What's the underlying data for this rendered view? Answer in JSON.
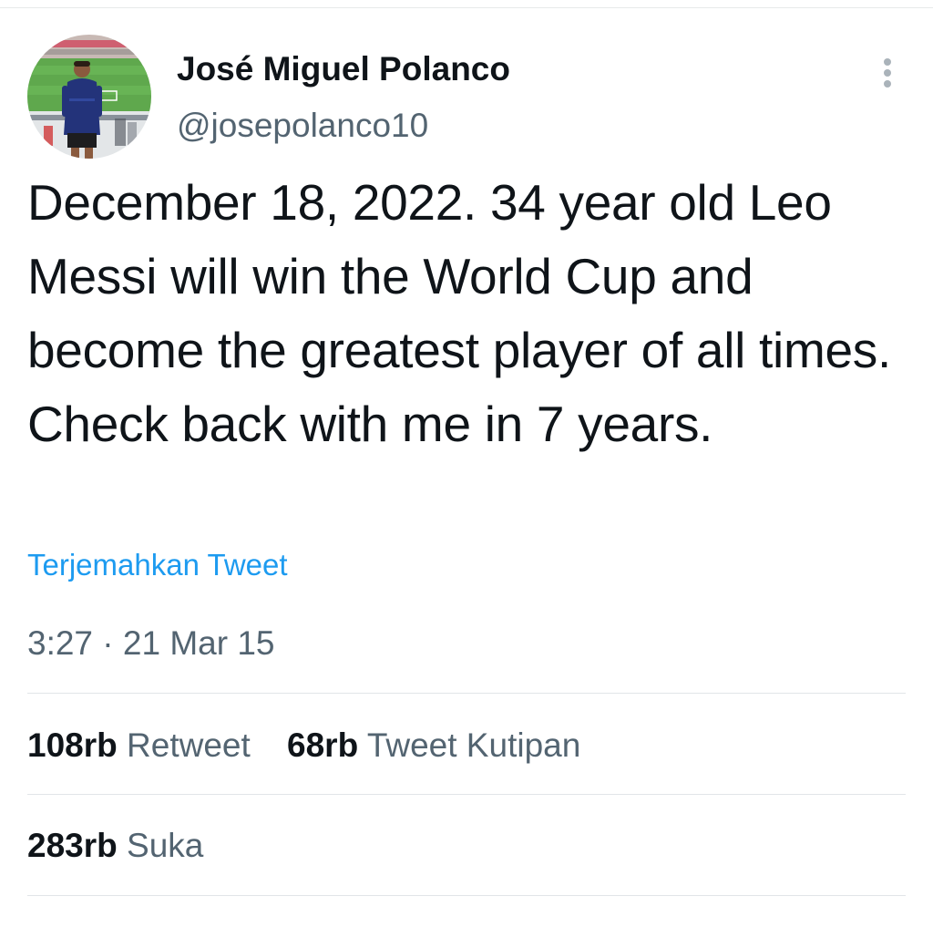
{
  "tweet": {
    "author": {
      "name": "José Miguel Polanco",
      "handle": "@josepolanco10"
    },
    "text": "December 18, 2022. 34 year old Leo Messi will win the World Cup and become the greatest player of all times. Check back with me in 7 years.",
    "translate_label": "Terjemahkan Tweet",
    "timestamp": "3:27 · 21 Mar 15"
  },
  "stats": {
    "retweets": {
      "count": "108rb",
      "label": "Retweet"
    },
    "quotes": {
      "count": "68rb",
      "label": "Tweet Kutipan"
    },
    "likes": {
      "count": "283rb",
      "label": "Suka"
    }
  },
  "colors": {
    "text_primary": "#0f1419",
    "text_secondary": "#536471",
    "link": "#1d9bf0",
    "divider": "#e1e5e8"
  },
  "icons": {
    "more": "vertical-ellipsis-icon"
  }
}
